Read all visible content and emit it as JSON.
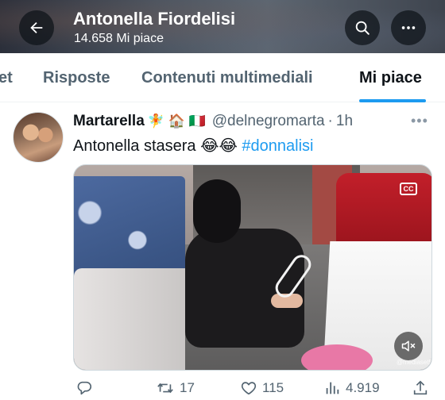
{
  "header": {
    "title": "Antonella Fiordelisi",
    "subtitle": "14.658 Mi piace",
    "back_icon": "arrow-left-icon",
    "search_icon": "search-icon",
    "more_icon": "more-horizontal-icon"
  },
  "tabs": [
    {
      "label": "et",
      "active": false
    },
    {
      "label": "Risposte",
      "active": false
    },
    {
      "label": "Contenuti multimediali",
      "active": false
    },
    {
      "label": "Mi piace",
      "active": true
    }
  ],
  "tweet": {
    "author_name": "Martarella",
    "author_emojis": "🧚 🏠 🇮🇹",
    "handle": "@delnegromarta",
    "separator": "·",
    "time": "1h",
    "more_label": "•••",
    "text_main": "Antonella stasera 😂😂",
    "hashtag": "#donnalisi",
    "media": {
      "cc_label": "CC",
      "watermark": "@mediaset5.tre  TikTok",
      "sound_icon": "speaker-muted-icon"
    },
    "actions": {
      "replies": "",
      "retweets": "17",
      "likes": "115",
      "views": "4.919"
    }
  },
  "colors": {
    "accent": "#1d9bf0",
    "text_primary": "#0f1419",
    "text_secondary": "#536471"
  }
}
